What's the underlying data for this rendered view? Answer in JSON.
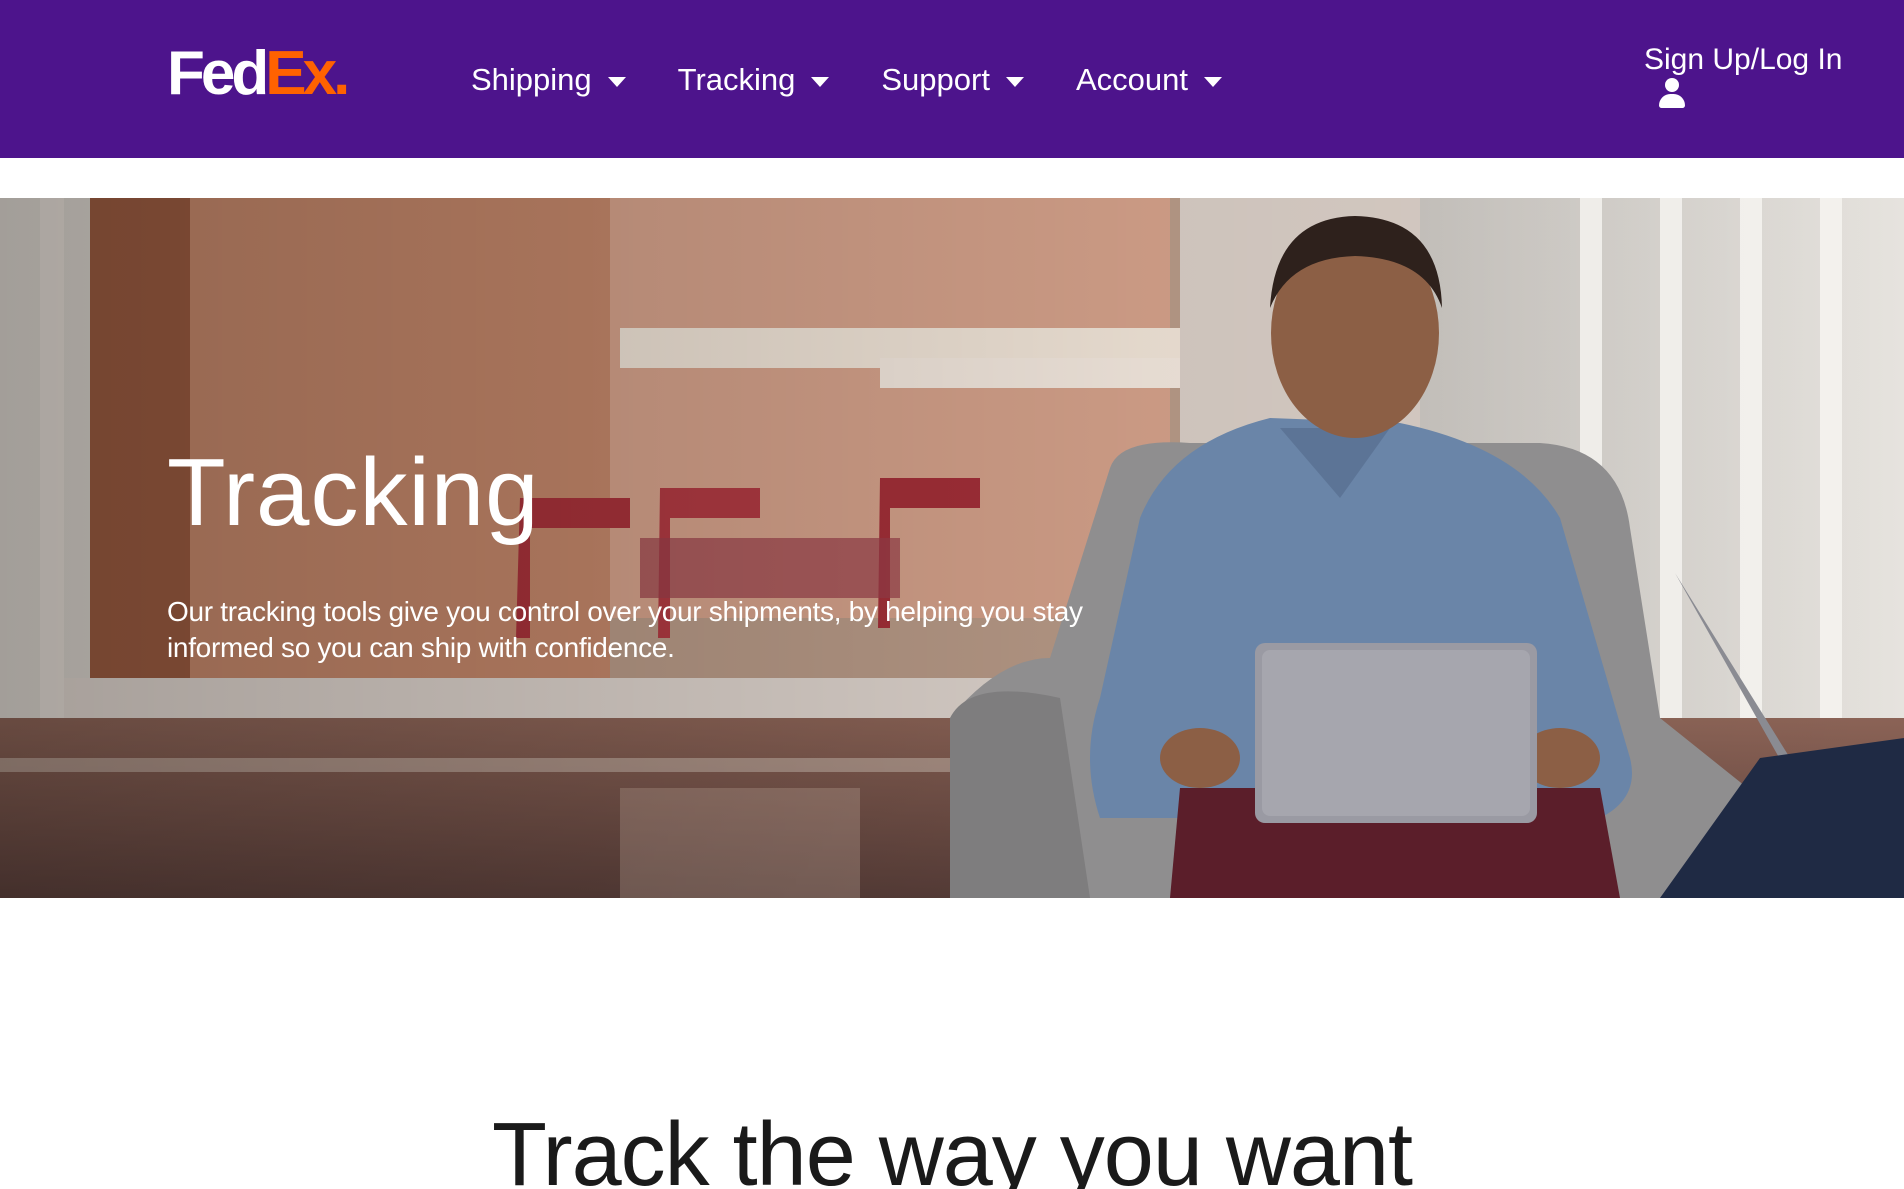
{
  "header": {
    "logo": {
      "part1": "Fed",
      "part2": "Ex."
    },
    "nav": [
      {
        "label": "Shipping"
      },
      {
        "label": "Tracking"
      },
      {
        "label": "Support"
      },
      {
        "label": "Account"
      }
    ],
    "signin_label": "Sign Up/Log In"
  },
  "hero": {
    "title": "Tracking",
    "text": "Our tracking tools give you control over your shipments, by helping you stay informed so you can ship with confidence."
  },
  "section": {
    "heading": "Track the way you want"
  },
  "colors": {
    "brand_purple": "#4d148c",
    "brand_orange": "#ff6200",
    "text_dark": "#1a1a1a"
  }
}
